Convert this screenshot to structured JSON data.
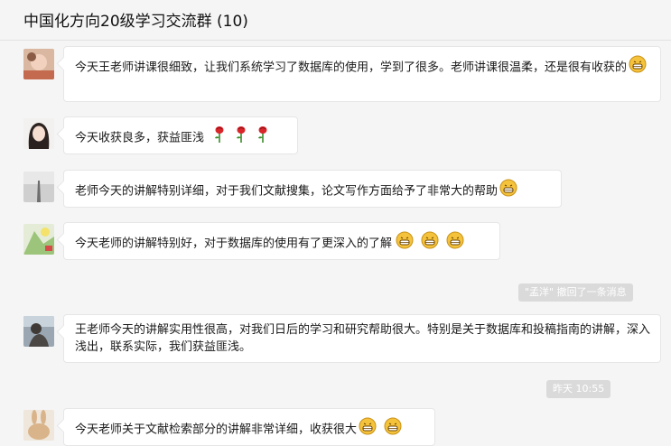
{
  "header": {
    "title": "中国化方向20级学习交流群 (10)"
  },
  "messages": [
    {
      "text": "今天王老师讲课很细致，让我们系统学习了数据库的使用，学到了很多。老师讲课很温柔，还是很有收获的",
      "emoji": [
        "grin"
      ]
    },
    {
      "text": "今天收获良多，获益匪浅",
      "emoji": [
        "rose",
        "rose",
        "rose"
      ]
    },
    {
      "text": "老师今天的讲解特别详细，对于我们文献搜集，论文写作方面给予了非常大的帮助",
      "emoji": [
        "grin"
      ]
    },
    {
      "text": "今天老师的讲解特别好，对于数据库的使用有了更深入的了解",
      "emoji": [
        "grin",
        "grin",
        "grin"
      ]
    },
    {
      "text": "王老师今天的讲解实用性很高，对我们日后的学习和研究帮助很大。特别是关于数据库和投稿指南的讲解，深入浅出，联系实际，我们获益匪浅。",
      "emoji": []
    },
    {
      "text": "今天老师关于文献检索部分的讲解非常详细，收获很大",
      "emoji": [
        "grin",
        "grin"
      ]
    }
  ],
  "system": {
    "recall": "\"孟洋\" 撤回了一条消息",
    "time": "昨天 10:55"
  },
  "colors": {
    "background": "#f5f5f5",
    "bubble": "#ffffff",
    "pill": "#dadada",
    "emoji": "#f5c33b"
  }
}
